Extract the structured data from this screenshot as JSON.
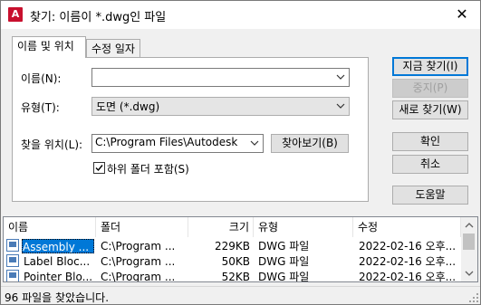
{
  "window": {
    "app_icon_letter": "A",
    "title": "찾기: 이름이 *.dwg인 파일",
    "close_glyph": "✕"
  },
  "tabs": [
    {
      "label": "이름 및 위치"
    },
    {
      "label": "수정 일자"
    }
  ],
  "form": {
    "name_label": "이름(N):",
    "name_value": "",
    "type_label": "유형(T):",
    "type_value": "도면 (*.dwg)",
    "lookin_label": "찾을 위치(L):",
    "lookin_value": "C:\\Program Files\\Autodesk",
    "browse_label": "찾아보기(B)",
    "subfolder_label": "하위 폴더 포함(S)",
    "subfolder_checked": true
  },
  "buttons": {
    "find_now": "지금 찾기(I)",
    "stop": "중지(P)",
    "new_search": "새로 찾기(W)",
    "ok": "확인",
    "cancel": "취소",
    "help": "도움말"
  },
  "results": {
    "columns": [
      "이름",
      "폴더",
      "크기",
      "유형",
      "수정"
    ],
    "rows": [
      {
        "name": "Assembly ...",
        "folder": "C:\\Program ...",
        "size": "229KB",
        "type": "DWG 파일",
        "modified": "2022-02-16 오후..."
      },
      {
        "name": "Label Bloc...",
        "folder": "C:\\Program ...",
        "size": "50KB",
        "type": "DWG 파일",
        "modified": "2022-02-16 오후..."
      },
      {
        "name": "Pointer Blo...",
        "folder": "C:\\Program ...",
        "size": "52KB",
        "type": "DWG 파일",
        "modified": "2022-02-16 오후..."
      }
    ]
  },
  "status": {
    "text": "96 파일을 찾았습니다."
  },
  "colors": {
    "accent": "#0078d7",
    "app_icon": "#c8102e"
  }
}
